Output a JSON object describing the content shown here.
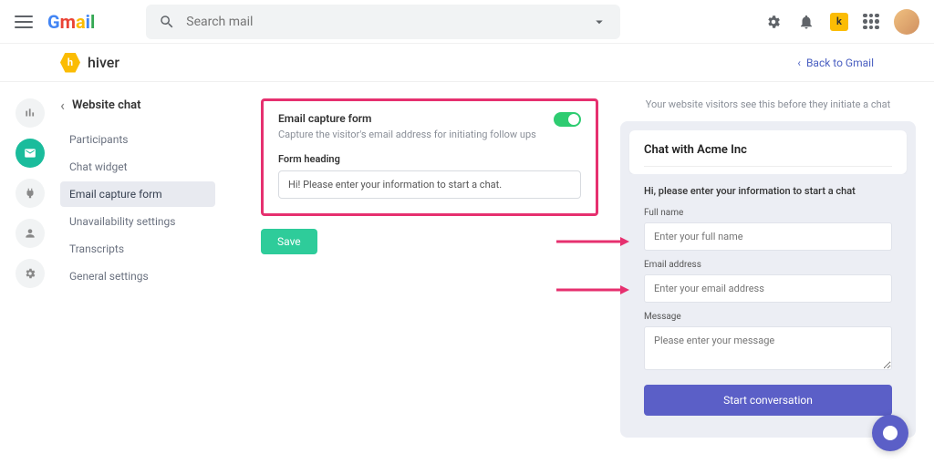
{
  "header": {
    "gmail_label": "Gmail",
    "search_placeholder": "Search mail"
  },
  "hiver": {
    "brand": "hiver",
    "back_label": "Back to Gmail"
  },
  "sidebar": {
    "title": "Website chat",
    "items": [
      {
        "label": "Participants"
      },
      {
        "label": "Chat widget"
      },
      {
        "label": "Email capture form"
      },
      {
        "label": "Unavailability settings"
      },
      {
        "label": "Transcripts"
      },
      {
        "label": "General settings"
      }
    ]
  },
  "form": {
    "section_title": "Email capture form",
    "section_desc": "Capture the visitor's email address for initiating follow ups",
    "heading_label": "Form heading",
    "heading_value": "Hi! Please enter your information to start a chat.",
    "save_label": "Save"
  },
  "preview": {
    "hint": "Your website visitors see this before they initiate a chat",
    "card_title": "Chat with Acme Inc",
    "subheading": "Hi, please enter your information to start a chat",
    "fullname_label": "Full name",
    "fullname_ph": "Enter your full name",
    "email_label": "Email address",
    "email_ph": "Enter your email address",
    "message_label": "Message",
    "message_ph": "Please enter your message",
    "start_label": "Start conversation"
  }
}
